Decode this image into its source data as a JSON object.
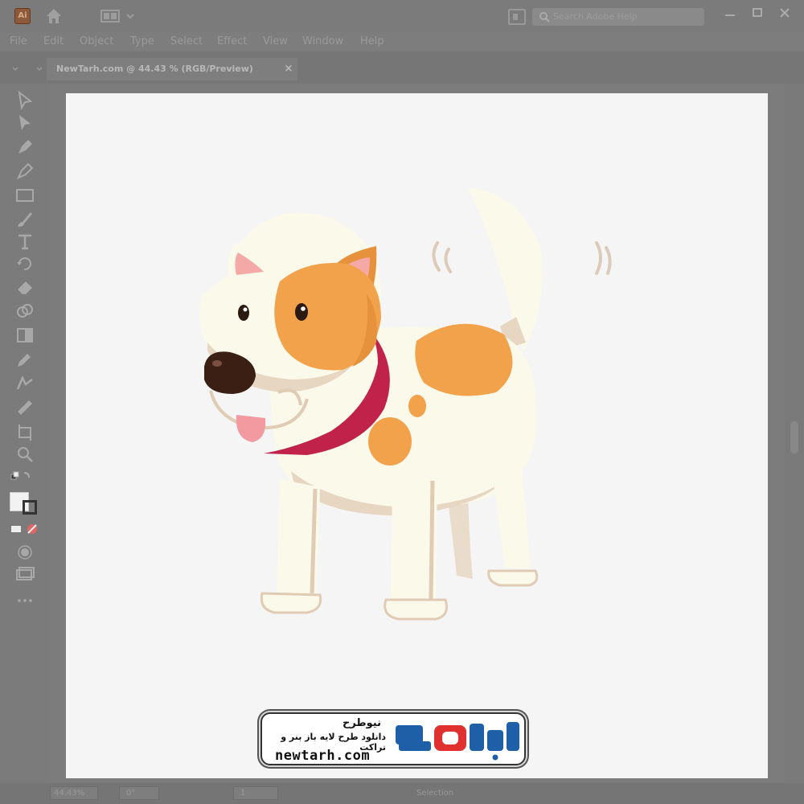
{
  "app": {
    "logo_text": "Ai",
    "search_placeholder": "Search Adobe Help"
  },
  "menu": [
    "File",
    "Edit",
    "Object",
    "Type",
    "Select",
    "Effect",
    "View",
    "Window",
    "Help"
  ],
  "document_tab": {
    "title": "NewTarh.com @ 44.43 % (RGB/Preview)",
    "close": "×"
  },
  "status": {
    "zoom": "44.43%",
    "rotation": "0°",
    "artboard_number": "1",
    "tool": "Selection"
  },
  "watermark": {
    "name": "نیوطرح",
    "tagline": "دانلود طرح لایه باز بنر و تراکت",
    "url": "newtarh.com",
    "logo_text": "نیوطرح"
  },
  "colors": {
    "dog_body": "#fbf9ea",
    "dog_spot": "#f2a24b",
    "collar": "#c0224a",
    "nose": "#3b1f14",
    "tongue": "#f39aa0",
    "shadow": "#e0cbb4",
    "logo_blue": "#1f5fa8",
    "logo_red": "#e03030"
  }
}
